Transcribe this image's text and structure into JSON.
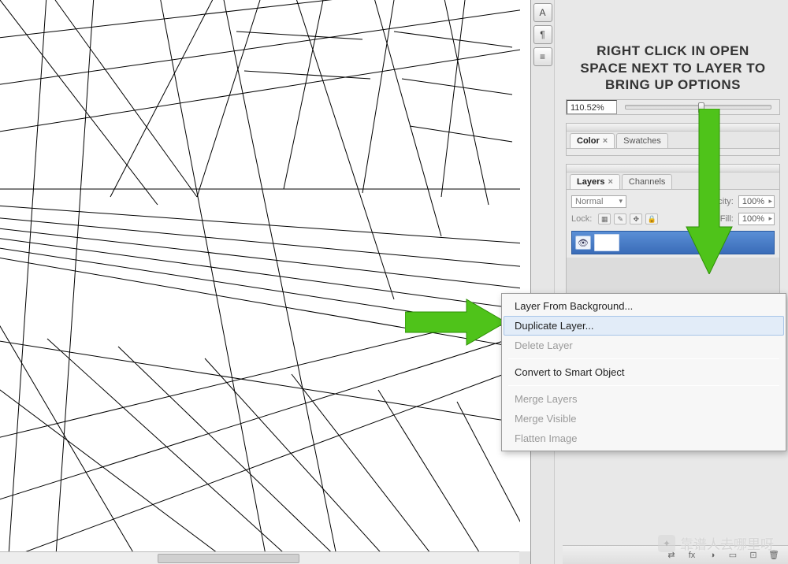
{
  "instruction": {
    "line1": "RIGHT CLICK IN OPEN",
    "line2": "SPACE NEXT TO LAYER TO",
    "line3": "BRING UP OPTIONS"
  },
  "zoom": {
    "value": "110.52%"
  },
  "color_panel": {
    "tabs": [
      "Color",
      "Swatches"
    ]
  },
  "layers_panel": {
    "tabs": [
      "Layers",
      "Channels"
    ],
    "blend_mode": "Normal",
    "opacity_label": "Opacity:",
    "opacity_value": "100%",
    "lock_label": "Lock:",
    "fill_label": "Fill:",
    "fill_value": "100%"
  },
  "footer_icons": [
    "⇄",
    "fx",
    "◑",
    "▭",
    "⊡",
    "🗑"
  ],
  "context_menu": {
    "items": [
      {
        "label": "Layer From Background...",
        "enabled": true
      },
      {
        "label": "Duplicate Layer...",
        "enabled": true,
        "hover": true
      },
      {
        "label": "Delete Layer",
        "enabled": false
      },
      {
        "sep": true
      },
      {
        "label": "Convert to Smart Object",
        "enabled": true
      },
      {
        "sep": true
      },
      {
        "label": "Merge Layers",
        "enabled": false
      },
      {
        "label": "Merge Visible",
        "enabled": false
      },
      {
        "label": "Flatten Image",
        "enabled": false
      }
    ]
  },
  "tool_icons": [
    "A",
    "¶",
    "≡"
  ],
  "watermark": "靠谱人去哪里呀"
}
